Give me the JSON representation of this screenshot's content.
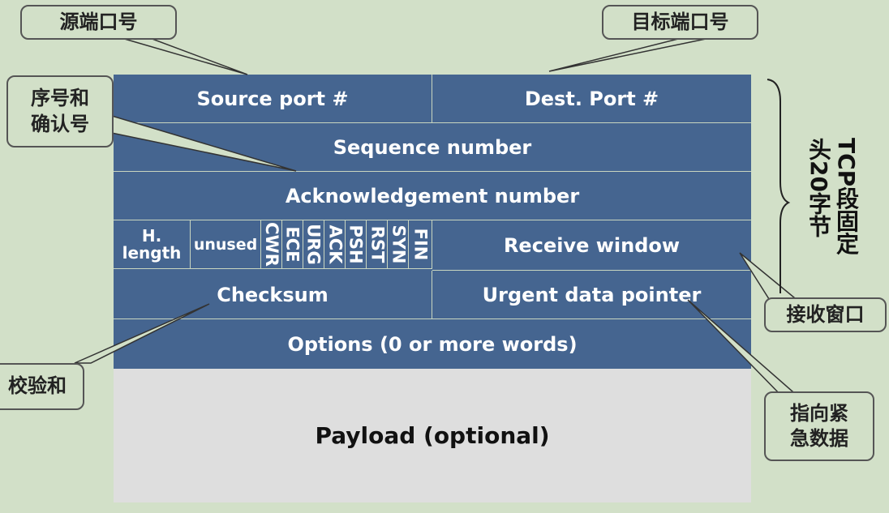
{
  "header": {
    "source_port": "Source port #",
    "dest_port": "Dest. Port #",
    "sequence": "Sequence number",
    "ack": "Acknowledgement number",
    "h_length_1": "H.",
    "h_length_2": "length",
    "unused": "unused",
    "flags": [
      "CWR",
      "ECE",
      "URG",
      "ACK",
      "PSH",
      "RST",
      "SYN",
      "FIN"
    ],
    "receive_window": "Receive window",
    "checksum": "Checksum",
    "urgent": "Urgent data pointer",
    "options": "Options (0 or more words)"
  },
  "payload": "Payload (optional)",
  "callouts": {
    "source_port": "源端口号",
    "dest_port": "目标端口号",
    "seq_ack_1": "序号和",
    "seq_ack_2": "确认号",
    "checksum": "校验和",
    "receive_window": "接收窗口",
    "urgent_1": "指向紧",
    "urgent_2": "急数据"
  },
  "side_label": "TCP段固定头20字节",
  "colors": {
    "background": "#d2e0c8",
    "header_fill": "#456590",
    "payload_fill": "#dedede",
    "header_text": "#ffffff"
  }
}
